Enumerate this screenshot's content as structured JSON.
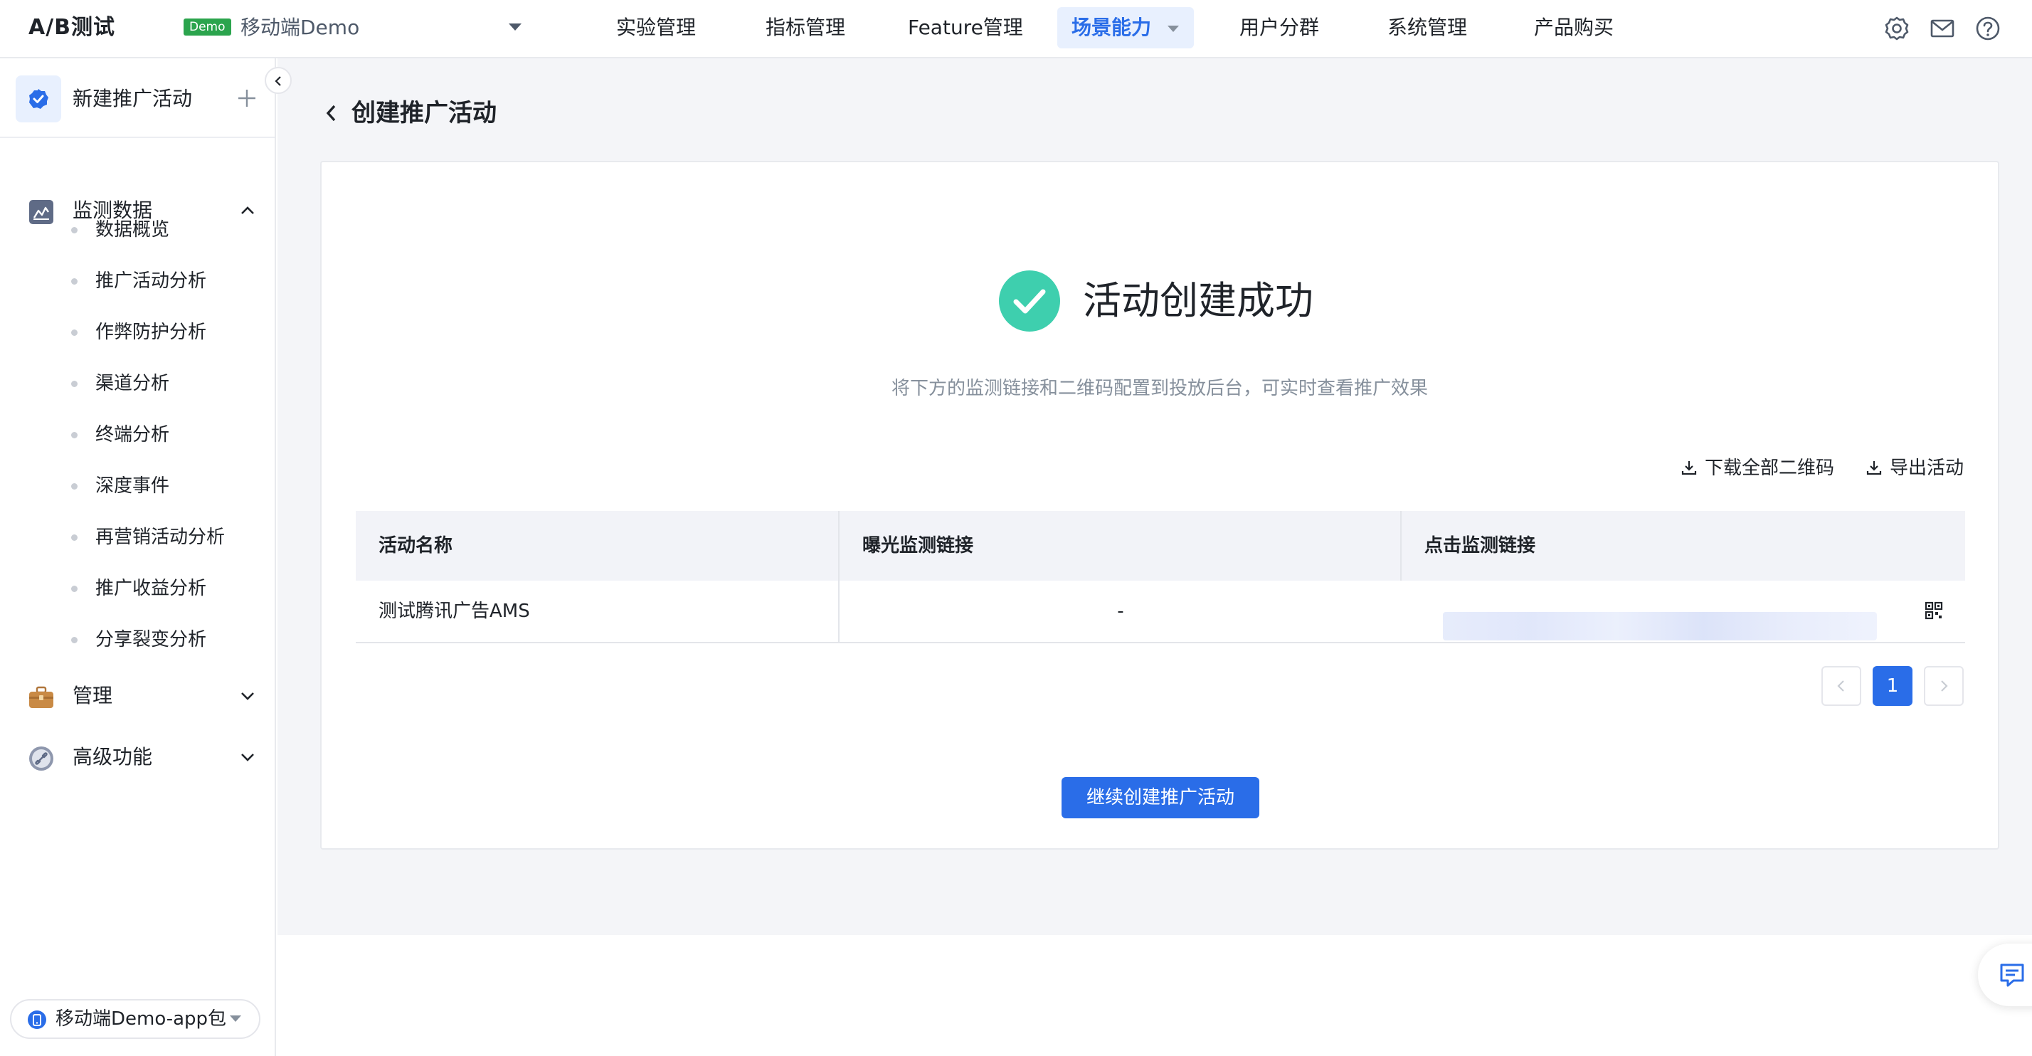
{
  "app": {
    "brand": "A/B测试",
    "demo_tag": "Demo",
    "project": "移动端Demo"
  },
  "nav": {
    "items": [
      "实验管理",
      "指标管理",
      "Feature管理",
      "场景能力",
      "用户分群",
      "系统管理",
      "产品购买"
    ],
    "active": "场景能力"
  },
  "header_icons": [
    "gear-icon",
    "mail-icon",
    "help-icon"
  ],
  "sidebar": {
    "new_activity": "新建推广活动",
    "groups": [
      {
        "label": "监测数据",
        "expanded": true,
        "items": [
          "数据概览",
          "推广活动分析",
          "作弊防护分析",
          "渠道分析",
          "终端分析",
          "深度事件",
          "再营销活动分析",
          "推广收益分析",
          "分享裂变分析"
        ]
      },
      {
        "label": "管理",
        "expanded": false
      },
      {
        "label": "高级功能",
        "expanded": false
      }
    ],
    "app_package": "移动端Demo-app包"
  },
  "page": {
    "title": "创建推广活动"
  },
  "result": {
    "title": "活动创建成功",
    "subtitle": "将下方的监测链接和二维码配置到投放后台，可实时查看推广效果",
    "download_all_qr": "下载全部二维码",
    "export_activity": "导出活动"
  },
  "table": {
    "headers": [
      "活动名称",
      "曝光监测链接",
      "点击监测链接"
    ],
    "rows": [
      {
        "name": "测试腾讯广告AMS",
        "exposure_link": "-",
        "click_link_blurred": true
      }
    ]
  },
  "pagination": {
    "current": "1"
  },
  "continue_button": "继续创建推广活动",
  "colors": {
    "primary": "#2a6de8",
    "success": "#3ecfae",
    "demo_tag": "#2ba44d",
    "background": "#f4f5f8"
  }
}
